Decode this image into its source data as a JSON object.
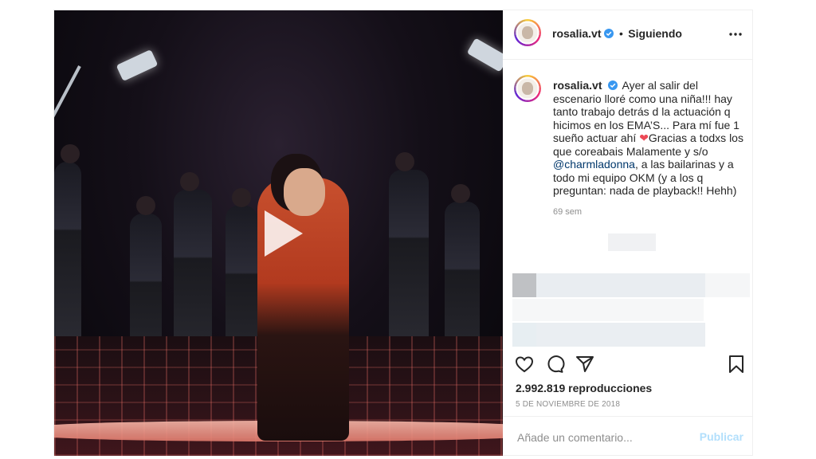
{
  "post": {
    "author": "rosalia.vt",
    "follow_state": "Siguiendo",
    "separator": "•",
    "caption_parts": [
      "Ayer al salir del escenario lloré como una niña!!! hay tanto trabajo detrás d la actuación q hicimos en los EMA’S... Para mí fue 1 sueño actuar ahí ",
      "Gracias a todxs los que coreabais Malamente y s/o ",
      "@charmladonna",
      ", a las bailarinas y a todo mi equipo OKM (y a los q preguntan: nada de playback!! Hehh)"
    ],
    "heart_emoji": "❤",
    "time_ago": "69 sem",
    "views": "2.992.819 reproducciones",
    "date": "5 DE NOVIEMBRE DE 2018"
  },
  "comment": {
    "placeholder": "Añade un comentario...",
    "publish_label": "Publicar"
  },
  "icons": {
    "more": "more-options-icon",
    "like": "heart-icon",
    "comment": "comment-icon",
    "share": "share-icon",
    "save": "bookmark-icon",
    "play": "play-icon",
    "verified": "verified-badge-icon"
  },
  "colors": {
    "verified": "#3897f0",
    "mention": "#00376b",
    "publish_disabled": "#b2dffc",
    "heart": "#ed4956"
  }
}
